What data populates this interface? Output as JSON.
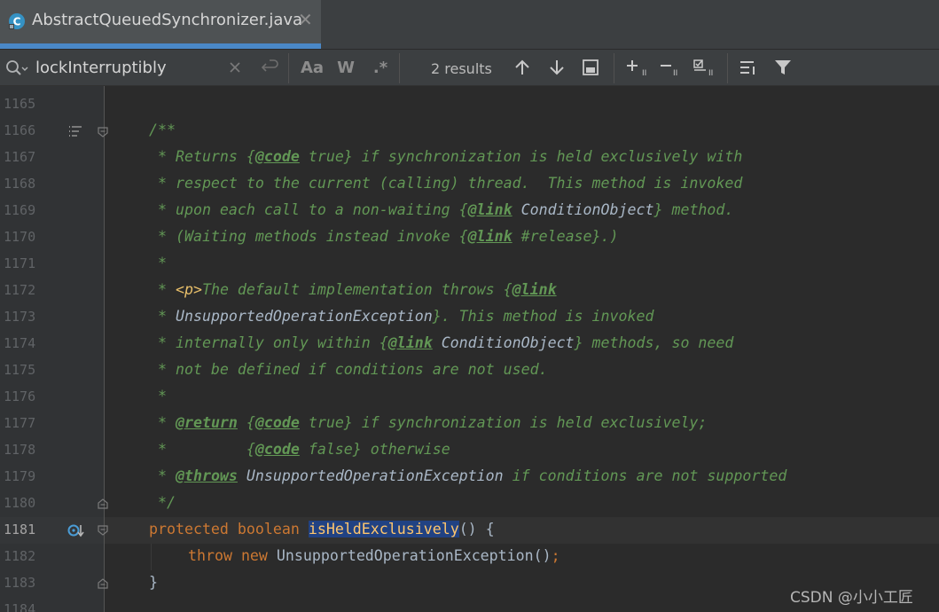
{
  "tab": {
    "title": "AbstractQueuedSynchronizer.java",
    "icon": "java-class-icon",
    "close": "✕"
  },
  "search": {
    "value": "lockInterruptibly",
    "results": "2 results",
    "case_label": "Aa",
    "word_label": "W",
    "regex_label": ".*"
  },
  "lines": {
    "n1165": "1165",
    "n1166": "1166",
    "n1167": "1167",
    "n1168": "1168",
    "n1169": "1169",
    "n1170": "1170",
    "n1171": "1171",
    "n1172": "1172",
    "n1173": "1173",
    "n1174": "1174",
    "n1175": "1175",
    "n1176": "1176",
    "n1177": "1177",
    "n1178": "1178",
    "n1179": "1179",
    "n1180": "1180",
    "n1181": "1181",
    "n1182": "1182",
    "n1183": "1183",
    "n1184": "1184"
  },
  "code": {
    "l1166": "/**",
    "l1167_a": " * Returns ",
    "l1167_b": "{",
    "l1167_tag": "@code",
    "l1167_c": " true} if synchronization is held exclusively with",
    "l1168": " * respect to the current (calling) thread.  This method is invoked",
    "l1169_a": " * upon each call to a non-waiting ",
    "l1169_b": "{",
    "l1169_tag": "@link",
    "l1169_ref": " ConditionObject",
    "l1169_c": "} method.",
    "l1170_a": " * (Waiting methods instead invoke ",
    "l1170_b": "{",
    "l1170_tag": "@link",
    "l1170_ref": " #release",
    "l1170_c": "}.)",
    "l1171": " *",
    "l1172_a": " * ",
    "l1172_html": "<p>",
    "l1172_b": "The default implementation throws ",
    "l1172_c": "{",
    "l1172_tag": "@link",
    "l1173_a": " * ",
    "l1173_ref": "UnsupportedOperationException",
    "l1173_b": "}. This method is invoked",
    "l1174_a": " * internally only within ",
    "l1174_b": "{",
    "l1174_tag": "@link",
    "l1174_ref": " ConditionObject",
    "l1174_c": "} methods, so need",
    "l1175": " * not be defined if conditions are not used.",
    "l1176": " *",
    "l1177_a": " * ",
    "l1177_tag": "@return",
    "l1177_b": " {",
    "l1177_tag2": "@code",
    "l1177_c": " true} if synchronization is held exclusively;",
    "l1178_a": " *         {",
    "l1178_tag": "@code",
    "l1178_b": " false} otherwise",
    "l1179_a": " * ",
    "l1179_tag": "@throws",
    "l1179_ref": " UnsupportedOperationException",
    "l1179_b": " if conditions are not supported",
    "l1180": " */",
    "l1181_kw1": "protected",
    "l1181_kw2": " boolean ",
    "l1181_fn": "isHeldExclusively",
    "l1181_rest": "() {",
    "l1182_kw1": "throw",
    "l1182_kw2": " new ",
    "l1182_rest": "UnsupportedOperationException()",
    "l1182_semi": ";",
    "l1183": "}"
  },
  "watermark": "CSDN @小小工匠"
}
